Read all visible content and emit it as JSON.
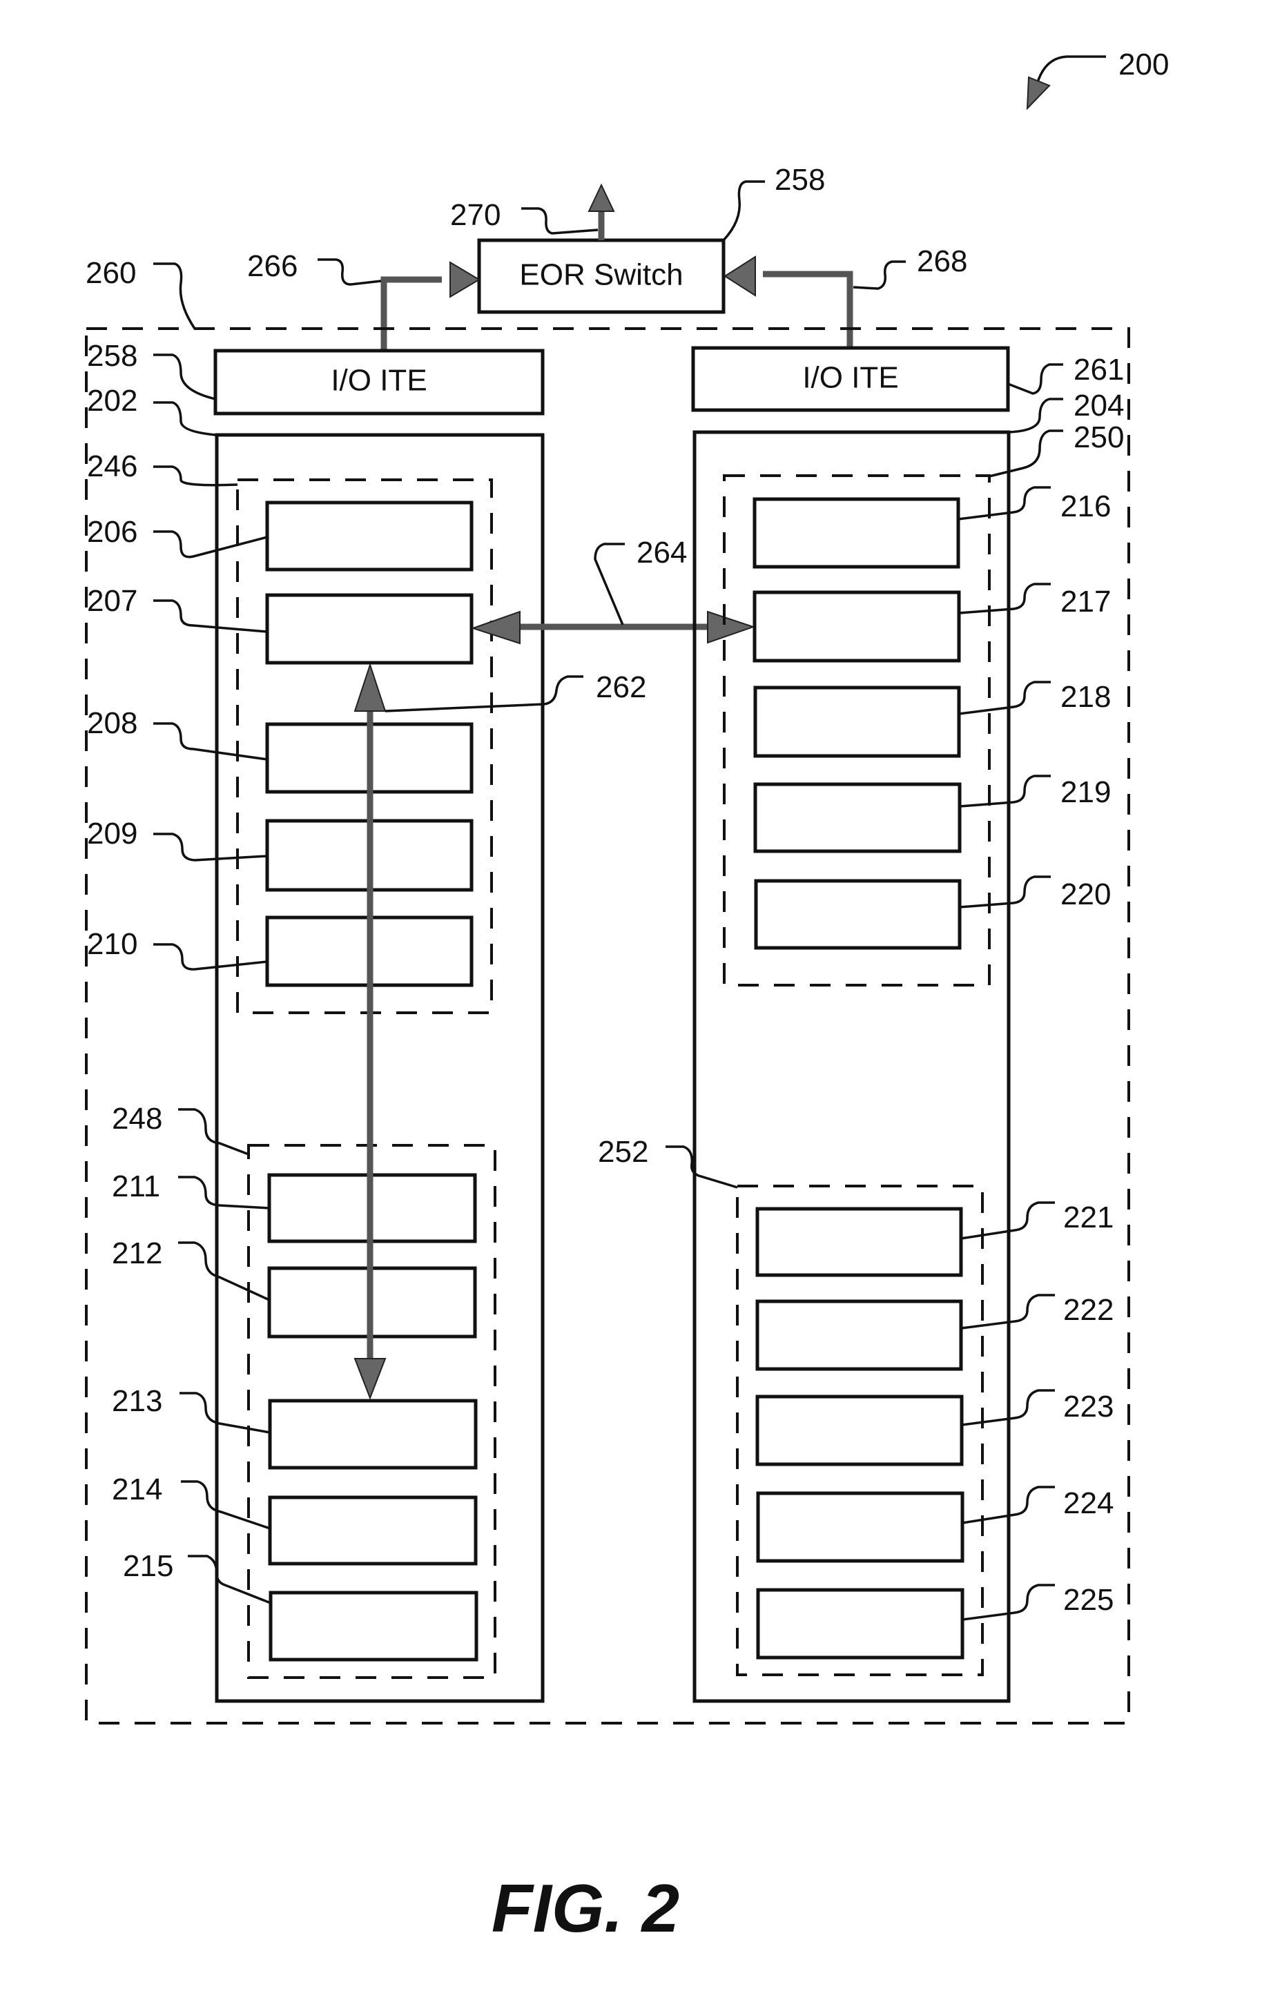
{
  "figure": {
    "caption": "FIG. 2",
    "figure_ref": "200"
  },
  "eor_switch": {
    "label": "EOR Switch",
    "ref": "258",
    "uplink_ref": "270"
  },
  "links": {
    "left_uplink_ref": "266",
    "right_uplink_ref": "268",
    "inter_rack_ref": "264",
    "intra_rack_ref": "262"
  },
  "container": {
    "ref": "260"
  },
  "left_rack": {
    "ref": "202",
    "io_ite": {
      "label": "I/O ITE",
      "ref": "258"
    },
    "groups": [
      {
        "ref": "246",
        "units": [
          "206",
          "207",
          "208",
          "209",
          "210"
        ]
      },
      {
        "ref": "248",
        "units": [
          "211",
          "212",
          "213",
          "214",
          "215"
        ]
      }
    ]
  },
  "right_rack": {
    "ref": "204",
    "io_ite": {
      "label": "I/O ITE",
      "ref": "261"
    },
    "groups": [
      {
        "ref": "250",
        "units": [
          "216",
          "217",
          "218",
          "219",
          "220"
        ]
      },
      {
        "ref": "252",
        "units": [
          "221",
          "222",
          "223",
          "224",
          "225"
        ]
      }
    ]
  }
}
